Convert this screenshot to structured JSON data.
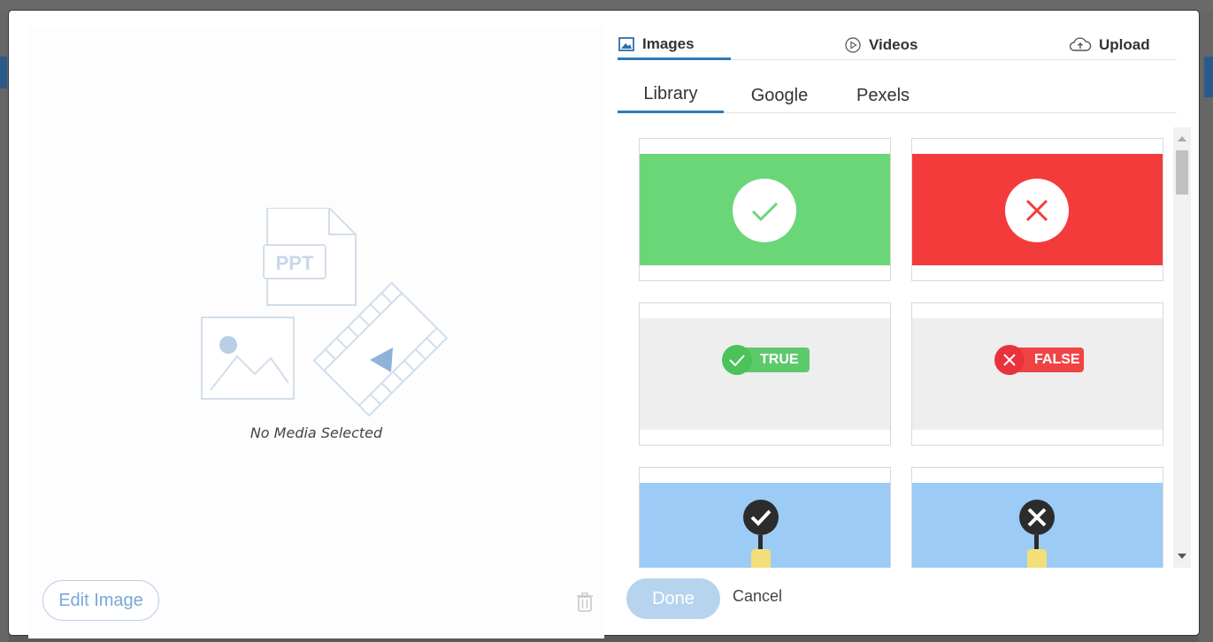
{
  "colors": {
    "accent": "#2f7ab8",
    "done_button": "#b6d4ee",
    "green_tile": "#6bd677",
    "red_tile": "#f43b3b",
    "blue_tile": "#9ccbf5"
  },
  "preview": {
    "empty_label": "No Media Selected",
    "ppt_label": "PPT",
    "edit_image_label": "Edit Image"
  },
  "top_tabs": [
    {
      "label": "Images",
      "icon": "image-icon",
      "active": true
    },
    {
      "label": "Videos",
      "icon": "play-circle-icon",
      "active": false
    },
    {
      "label": "Upload",
      "icon": "cloud-upload-icon",
      "active": false
    }
  ],
  "sub_tabs": [
    {
      "label": "Library",
      "active": true
    },
    {
      "label": "Google",
      "active": false
    },
    {
      "label": "Pexels",
      "active": false
    }
  ],
  "thumbnails": [
    {
      "kind": "check-green"
    },
    {
      "kind": "x-red"
    },
    {
      "kind": "true-badge",
      "label": "TRUE"
    },
    {
      "kind": "false-badge",
      "label": "FALSE"
    },
    {
      "kind": "hand-check-blue"
    },
    {
      "kind": "hand-x-blue"
    }
  ],
  "footer": {
    "done_label": "Done",
    "cancel_label": "Cancel"
  }
}
